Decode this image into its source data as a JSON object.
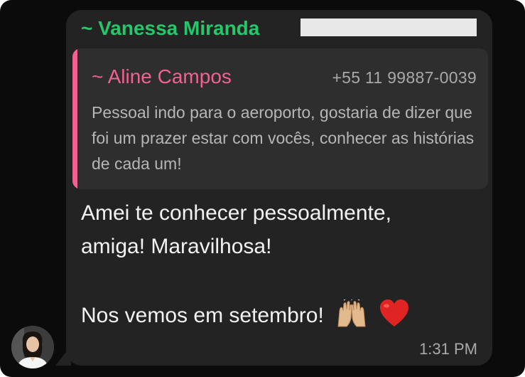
{
  "chat": {
    "sender_name": "~ Vanessa Miranda",
    "quoted_message": {
      "author": "~ Aline Campos",
      "phone": "+55 11 99887-0039",
      "text": "Pessoal indo para o aeroporto, gostaria de dizer que foi um prazer estar com vocês, conhecer as histórias de cada um!"
    },
    "message_lines": [
      "Amei te conhecer pessoalmente,",
      "amiga! Maravilhosa!",
      "Nos vemos em setembro!"
    ],
    "emojis": [
      "raising-hands-icon",
      "red-heart-icon"
    ],
    "timestamp": "1:31 PM"
  },
  "colors": {
    "background": "#0b0b0b",
    "bubble": "#232323",
    "quote_background": "#2e2e2e",
    "sender_name": "#25c76a",
    "quote_accent": "#f06292",
    "message_text": "#f2f2f2",
    "meta_text": "#a9a9a9"
  }
}
